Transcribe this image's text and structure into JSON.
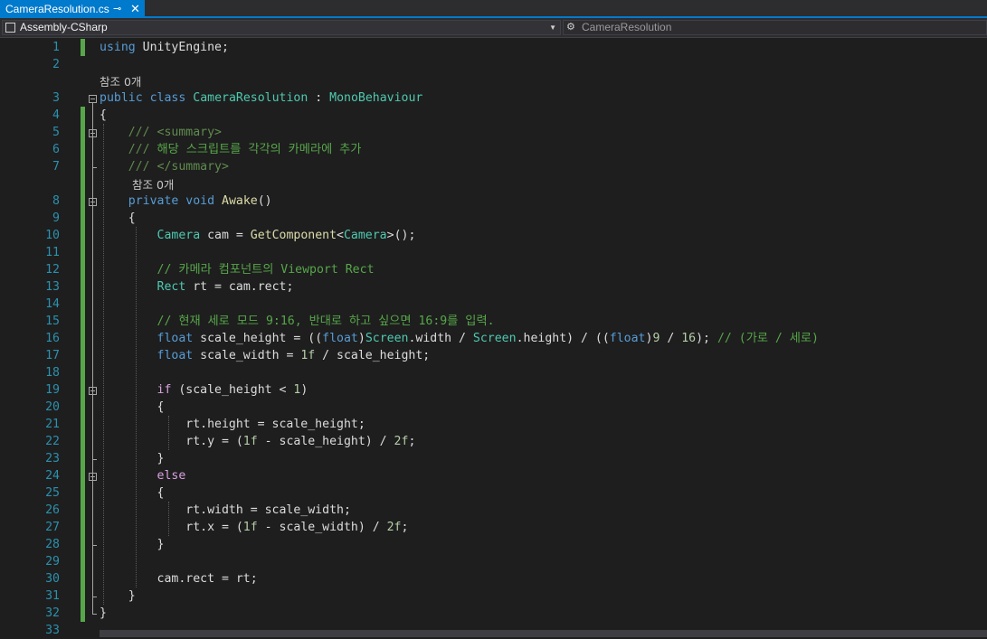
{
  "tab": {
    "title": "CameraResolution.cs",
    "pin_icon": "pin-icon",
    "close_icon": "close-icon"
  },
  "navbar": {
    "project": "Assembly-CSharp",
    "project_icon": "csharp-project-icon",
    "class_name": "CameraResolution",
    "class_icon": "class-member-icon"
  },
  "code_lens": "참조 0개",
  "syntax_colors": {
    "keyword": "#569cd6",
    "type": "#4ec9b0",
    "method": "#dcdcaa",
    "comment": "#57a64a",
    "number": "#b5cea8",
    "control": "#d8a0df",
    "plain": "#dcdcdc",
    "line_number": "#2b91af",
    "changed_marker": "#57a64a"
  },
  "lines": [
    {
      "n": "1",
      "tokens": [
        [
          "k",
          "using"
        ],
        [
          "p",
          " UnityEngine;"
        ]
      ]
    },
    {
      "n": "2",
      "tokens": []
    },
    {
      "n": "3",
      "tokens": [
        [
          "k",
          "public"
        ],
        [
          "p",
          " "
        ],
        [
          "k",
          "class"
        ],
        [
          "p",
          " "
        ],
        [
          "t",
          "CameraResolution"
        ],
        [
          "p",
          " : "
        ],
        [
          "t",
          "MonoBehaviour"
        ]
      ]
    },
    {
      "n": "4",
      "tokens": [
        [
          "p",
          "{"
        ]
      ]
    },
    {
      "n": "5",
      "tokens": [
        [
          "p",
          "    "
        ],
        [
          "x",
          "/// "
        ],
        [
          "x",
          "<summary>"
        ]
      ]
    },
    {
      "n": "6",
      "tokens": [
        [
          "p",
          "    "
        ],
        [
          "x",
          "/// "
        ],
        [
          "c",
          "해당 스크립트를 각각의 카메라에 추가"
        ]
      ]
    },
    {
      "n": "7",
      "tokens": [
        [
          "p",
          "    "
        ],
        [
          "x",
          "/// "
        ],
        [
          "x",
          "</summary>"
        ]
      ]
    },
    {
      "n": "8",
      "tokens": [
        [
          "p",
          "    "
        ],
        [
          "k",
          "private"
        ],
        [
          "p",
          " "
        ],
        [
          "k",
          "void"
        ],
        [
          "p",
          " "
        ],
        [
          "m",
          "Awake"
        ],
        [
          "p",
          "()"
        ]
      ]
    },
    {
      "n": "9",
      "tokens": [
        [
          "p",
          "    {"
        ]
      ]
    },
    {
      "n": "10",
      "tokens": [
        [
          "p",
          "        "
        ],
        [
          "t",
          "Camera"
        ],
        [
          "p",
          " cam = "
        ],
        [
          "m",
          "GetComponent"
        ],
        [
          "p",
          "<"
        ],
        [
          "t",
          "Camera"
        ],
        [
          "p",
          ">();"
        ]
      ]
    },
    {
      "n": "11",
      "tokens": []
    },
    {
      "n": "12",
      "tokens": [
        [
          "p",
          "        "
        ],
        [
          "c",
          "// 카메라 컴포넌트의 Viewport Rect"
        ]
      ]
    },
    {
      "n": "13",
      "tokens": [
        [
          "p",
          "        "
        ],
        [
          "t",
          "Rect"
        ],
        [
          "p",
          " rt = cam.rect;"
        ]
      ]
    },
    {
      "n": "14",
      "tokens": []
    },
    {
      "n": "15",
      "tokens": [
        [
          "p",
          "        "
        ],
        [
          "c",
          "// 현재 세로 모드 9:16, 반대로 하고 싶으면 16:9를 입력."
        ]
      ]
    },
    {
      "n": "16",
      "tokens": [
        [
          "p",
          "        "
        ],
        [
          "k",
          "float"
        ],
        [
          "p",
          " scale_height = (("
        ],
        [
          "k",
          "float"
        ],
        [
          "p",
          ")"
        ],
        [
          "t",
          "Screen"
        ],
        [
          "p",
          ".width / "
        ],
        [
          "t",
          "Screen"
        ],
        [
          "p",
          ".height) / (("
        ],
        [
          "k",
          "float"
        ],
        [
          "p",
          ")"
        ],
        [
          "n",
          "9"
        ],
        [
          "p",
          " / "
        ],
        [
          "n",
          "16"
        ],
        [
          "p",
          "); "
        ],
        [
          "c",
          "// (가로 / 세로)"
        ]
      ]
    },
    {
      "n": "17",
      "tokens": [
        [
          "p",
          "        "
        ],
        [
          "k",
          "float"
        ],
        [
          "p",
          " scale_width = "
        ],
        [
          "n",
          "1f"
        ],
        [
          "p",
          " / scale_height;"
        ]
      ]
    },
    {
      "n": "18",
      "tokens": []
    },
    {
      "n": "19",
      "tokens": [
        [
          "p",
          "        "
        ],
        [
          "ct",
          "if"
        ],
        [
          "p",
          " (scale_height < "
        ],
        [
          "n",
          "1"
        ],
        [
          "p",
          ")"
        ]
      ]
    },
    {
      "n": "20",
      "tokens": [
        [
          "p",
          "        {"
        ]
      ]
    },
    {
      "n": "21",
      "tokens": [
        [
          "p",
          "            rt.height = scale_height;"
        ]
      ]
    },
    {
      "n": "22",
      "tokens": [
        [
          "p",
          "            rt.y = ("
        ],
        [
          "n",
          "1f"
        ],
        [
          "p",
          " - scale_height) / "
        ],
        [
          "n",
          "2f"
        ],
        [
          "p",
          ";"
        ]
      ]
    },
    {
      "n": "23",
      "tokens": [
        [
          "p",
          "        }"
        ]
      ]
    },
    {
      "n": "24",
      "tokens": [
        [
          "p",
          "        "
        ],
        [
          "ct",
          "else"
        ]
      ]
    },
    {
      "n": "25",
      "tokens": [
        [
          "p",
          "        {"
        ]
      ]
    },
    {
      "n": "26",
      "tokens": [
        [
          "p",
          "            rt.width = scale_width;"
        ]
      ]
    },
    {
      "n": "27",
      "tokens": [
        [
          "p",
          "            rt.x = ("
        ],
        [
          "n",
          "1f"
        ],
        [
          "p",
          " - scale_width) / "
        ],
        [
          "n",
          "2f"
        ],
        [
          "p",
          ";"
        ]
      ]
    },
    {
      "n": "28",
      "tokens": [
        [
          "p",
          "        }"
        ]
      ]
    },
    {
      "n": "29",
      "tokens": []
    },
    {
      "n": "30",
      "tokens": [
        [
          "p",
          "        cam.rect = rt;"
        ]
      ]
    },
    {
      "n": "31",
      "tokens": [
        [
          "p",
          "    }"
        ]
      ]
    },
    {
      "n": "32",
      "tokens": [
        [
          "p",
          "}"
        ]
      ]
    },
    {
      "n": "33",
      "tokens": []
    }
  ]
}
